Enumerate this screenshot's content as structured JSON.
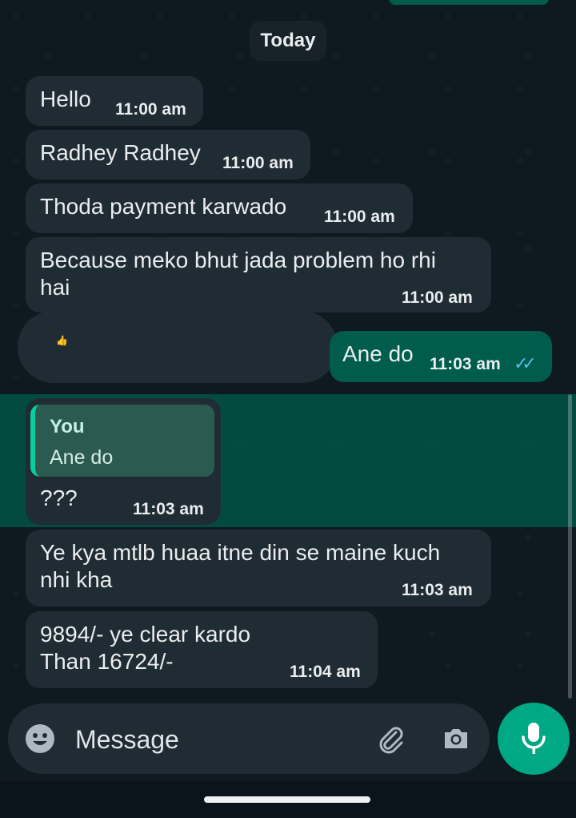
{
  "chat": {
    "date_label": "Today",
    "messages": [
      {
        "text": "Hello",
        "time": "11:00 am"
      },
      {
        "text": "Radhey Radhey",
        "time": "11:00 am"
      },
      {
        "text": "Thoda payment karwado",
        "time": "11:00 am"
      },
      {
        "text": "Because meko bhut jada problem ho rhi\nhai",
        "time": "11:00 am"
      },
      {
        "text": "Ane do",
        "time": "11:03 am",
        "status": "read"
      },
      {
        "reply_to": {
          "author": "You",
          "text": "Ane do"
        },
        "text": "???",
        "time": "11:03 am"
      },
      {
        "text": "Ye kya mtlb huaa itne din se maine kuch\nnhi kha",
        "time": "11:03 am"
      },
      {
        "text": "9894/- ye  clear kardo\nThan 16724/-",
        "time": "11:04 am"
      }
    ]
  },
  "composer": {
    "placeholder": "Message"
  },
  "colors": {
    "incoming_bubble": "#202c33",
    "outgoing_bubble": "#005c4b",
    "accent": "#00a884",
    "read_ticks": "#53bdeb"
  }
}
